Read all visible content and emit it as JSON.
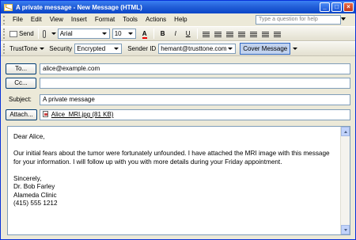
{
  "title": "A private message - New Message (HTML)",
  "menu": [
    "File",
    "Edit",
    "View",
    "Insert",
    "Format",
    "Tools",
    "Actions",
    "Help"
  ],
  "help_placeholder": "Type a question for help",
  "toolbar1": {
    "send": "Send",
    "font": "Arial",
    "size": "10",
    "bold": "B",
    "italic": "I",
    "underline": "U"
  },
  "toolbar2": {
    "trusttone": "TrustTone",
    "security_label": "Security",
    "security_value": "Encrypted",
    "sender_id_label": "Sender ID",
    "sender_id_value": "hemant@trusttone.com",
    "cover_message": "Cover Message"
  },
  "header": {
    "to_label": "To...",
    "to_value": "alice@example.com",
    "cc_label": "Cc...",
    "cc_value": "",
    "subject_label": "Subject:",
    "subject_value": "A private message",
    "attach_label": "Attach...",
    "attachment_name": "Alice_MRI.jpg (81 KB)"
  },
  "body": {
    "text": "Dear Alice,\n\nOur initial fears about the tumor were fortunately unfounded. I have attached the MRI image with this message for your information. I will follow up with you with more details during your Friday appointment.\n\nSincerely,\nDr. Bob Farley\nAlameda Clinic\n(415) 555 1212"
  }
}
